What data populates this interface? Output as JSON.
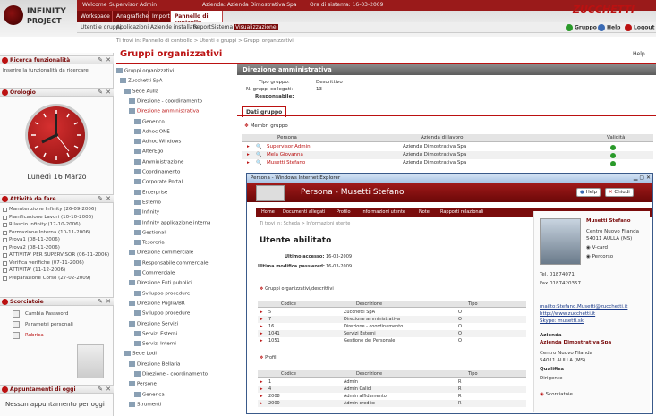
{
  "app": {
    "logo_line1": "INFINITY",
    "logo_line2": "PROJECT",
    "brand": "ZUCCHETTI"
  },
  "topbar": {
    "welcome": "Welcome",
    "user": "Supervisor Admin",
    "company": "Azienda: Azienda Dimostrativa Spa",
    "date_label": "Ora di sistema: 16-03-2009"
  },
  "tabs": [
    "Workspace",
    "Anagrafiche",
    "Import",
    "Pannello di controllo"
  ],
  "subtabs": [
    "Utenti e gruppi",
    "Applicazioni",
    "Aziende installate",
    "Report",
    "Sistema",
    "Visualizzazione"
  ],
  "topicons": {
    "gruppo": "Gruppo",
    "help": "Help",
    "logout": "Logout"
  },
  "left": {
    "widgets": [
      {
        "title": "Ricerca funzionalità",
        "placeholder": "Inserire la funzionalità da ricercare"
      },
      {
        "title": "Orologio"
      },
      {
        "title": "Attività da fare"
      },
      {
        "title": "Scorciatoie"
      },
      {
        "title": "Appuntamenti di oggi"
      }
    ],
    "date": "Lunedì 16 Marzo",
    "activities": [
      "Manutenzione Infinity (26-09-2006)",
      "Pianificazione Lavori (10-10-2006)",
      "Rilascio Infinity (17-10-2006)",
      "Formazione Interna (10-11-2006)",
      "Prova1 (08-11-2006)",
      "Prova2 (08-11-2006)",
      "ATTIVITA' PER SUPERVISOR (06-11-2006)",
      "Verifica verifiche (07-11-2006)",
      "ATTIVITA' (11-12-2006)",
      "Preparazione Corso (27-02-2009)"
    ],
    "shortcuts": [
      "Cambia Password",
      "Parametri personali",
      "Rubrica"
    ],
    "appointments_empty": "Nessun appuntamento per oggi"
  },
  "crumb": "Ti trovi in: Pannello di controllo > Utenti e gruppi > Gruppi organizzativi",
  "page_title": "Gruppi organizzativi",
  "help_label": "Help",
  "tree": [
    "Gruppi organizzativi",
    "Zucchetti SpA",
    "Sede Aulla",
    "Direzione - coordinamento",
    "Direzione amministrativa",
    "Generico",
    "Adhoc ONE",
    "Adhoc Windows",
    "AlterEgo",
    "Amministrazione",
    "Coordinamento",
    "Corporate Portal",
    "Enterprise",
    "Esterno",
    "Infinity",
    "Infinity applicazione interna",
    "Gestionali",
    "Tesoreria",
    "Direzione commerciale",
    "Responsabile commerciale",
    "Commerciale",
    "Direzione Enti pubblici",
    "Sviluppo procedure",
    "Direzione Puglia/BR",
    "Sviluppo procedure",
    "Direzione Servizi",
    "Servizi Esterni",
    "Servizi Interni",
    "Sede Lodi",
    "Direzione Bellaria",
    "Direzione - coordinamento",
    "Persone",
    "Generica",
    "Strumenti"
  ],
  "detail": {
    "header": "Direzione amministrativa",
    "tipo_label": "Tipo gruppo:",
    "tipo_value": "Descrittivo",
    "ncol_label": "N. gruppi collegati:",
    "ncol_value": "13",
    "resp_label": "Responsabile:",
    "resp_value": "",
    "tab": "Dati gruppo",
    "members_title": "Membri gruppo",
    "columns": [
      "Persona",
      "Azienda di lavoro",
      "Validità"
    ],
    "rows": [
      {
        "persona": "Supervisor Admin",
        "azienda": "Azienda Dimostrativa Spa"
      },
      {
        "persona": "Mela Giovanna",
        "azienda": "Azienda Dimostrativa Spa"
      },
      {
        "persona": "Musetti Stefano",
        "azienda": "Azienda Dimostrativa Spa"
      }
    ]
  },
  "popup": {
    "window_title": "Persona - Windows Internet Explorer",
    "header_title": "Persona - Musetti Stefano",
    "help": "Help",
    "close": "Chiudi",
    "nav": [
      "Home",
      "Documenti allegati",
      "Profilo",
      "Informazioni utente",
      "Note",
      "Rapporti relazionali"
    ],
    "crumb": "Ti trovi in: Scheda > Informazioni utente",
    "title": "Utente abilitato",
    "last_access_label": "Ultimo accesso:",
    "last_access_value": "16-03-2009",
    "last_pwd_label": "Ultima modifica password:",
    "last_pwd_value": "16-03-2009",
    "groups_title": "Gruppi organizzativi/descrittivi",
    "groups_cols": [
      "Codice",
      "Descrizione",
      "Tipo"
    ],
    "groups_rows": [
      {
        "c": "5",
        "d": "Zucchetti SpA",
        "t": "O"
      },
      {
        "c": "7",
        "d": "Direzione amministrativa",
        "t": "O"
      },
      {
        "c": "16",
        "d": "Direzione - coordinamento",
        "t": "O"
      },
      {
        "c": "1041",
        "d": "Servizi Esterni",
        "t": "O"
      },
      {
        "c": "1051",
        "d": "Gestione del Personale",
        "t": "O"
      }
    ],
    "profili_title": "Profili",
    "prof_cols": [
      "Codice",
      "Descrizione",
      "Tipo"
    ],
    "prof_rows": [
      {
        "c": "1",
        "d": "Admin",
        "t": "R"
      },
      {
        "c": "4",
        "d": "Admin Calidi",
        "t": "R"
      },
      {
        "c": "2008",
        "d": "Admin affidamento",
        "t": "R"
      },
      {
        "c": "2000",
        "d": "Admin credito",
        "t": "R"
      }
    ],
    "card": {
      "name": "Musetti Stefano",
      "addr1": "Centro Nuovo Filanda",
      "addr2": "54011 AULLA (MS)",
      "vcard": "V-card",
      "percorso": "Percorso",
      "tel": "Tel. 01874071",
      "fax": "Fax 0187420357",
      "email": "mailto:Stefano.Musetti@zucchetti.it",
      "web": "http://www.zucchetti.it",
      "skype": "Skype: musetti.sk",
      "azienda_label": "Azienda",
      "azienda": "Azienda Dimostrativa Spa",
      "azienda_addr1": "Centro Nuovo Filanda",
      "azienda_addr2": "54011 AULLA (MS)",
      "qualifica_label": "Qualifica",
      "qualifica": "Dirigente",
      "scorciatoie": "Scorciatoie"
    }
  }
}
